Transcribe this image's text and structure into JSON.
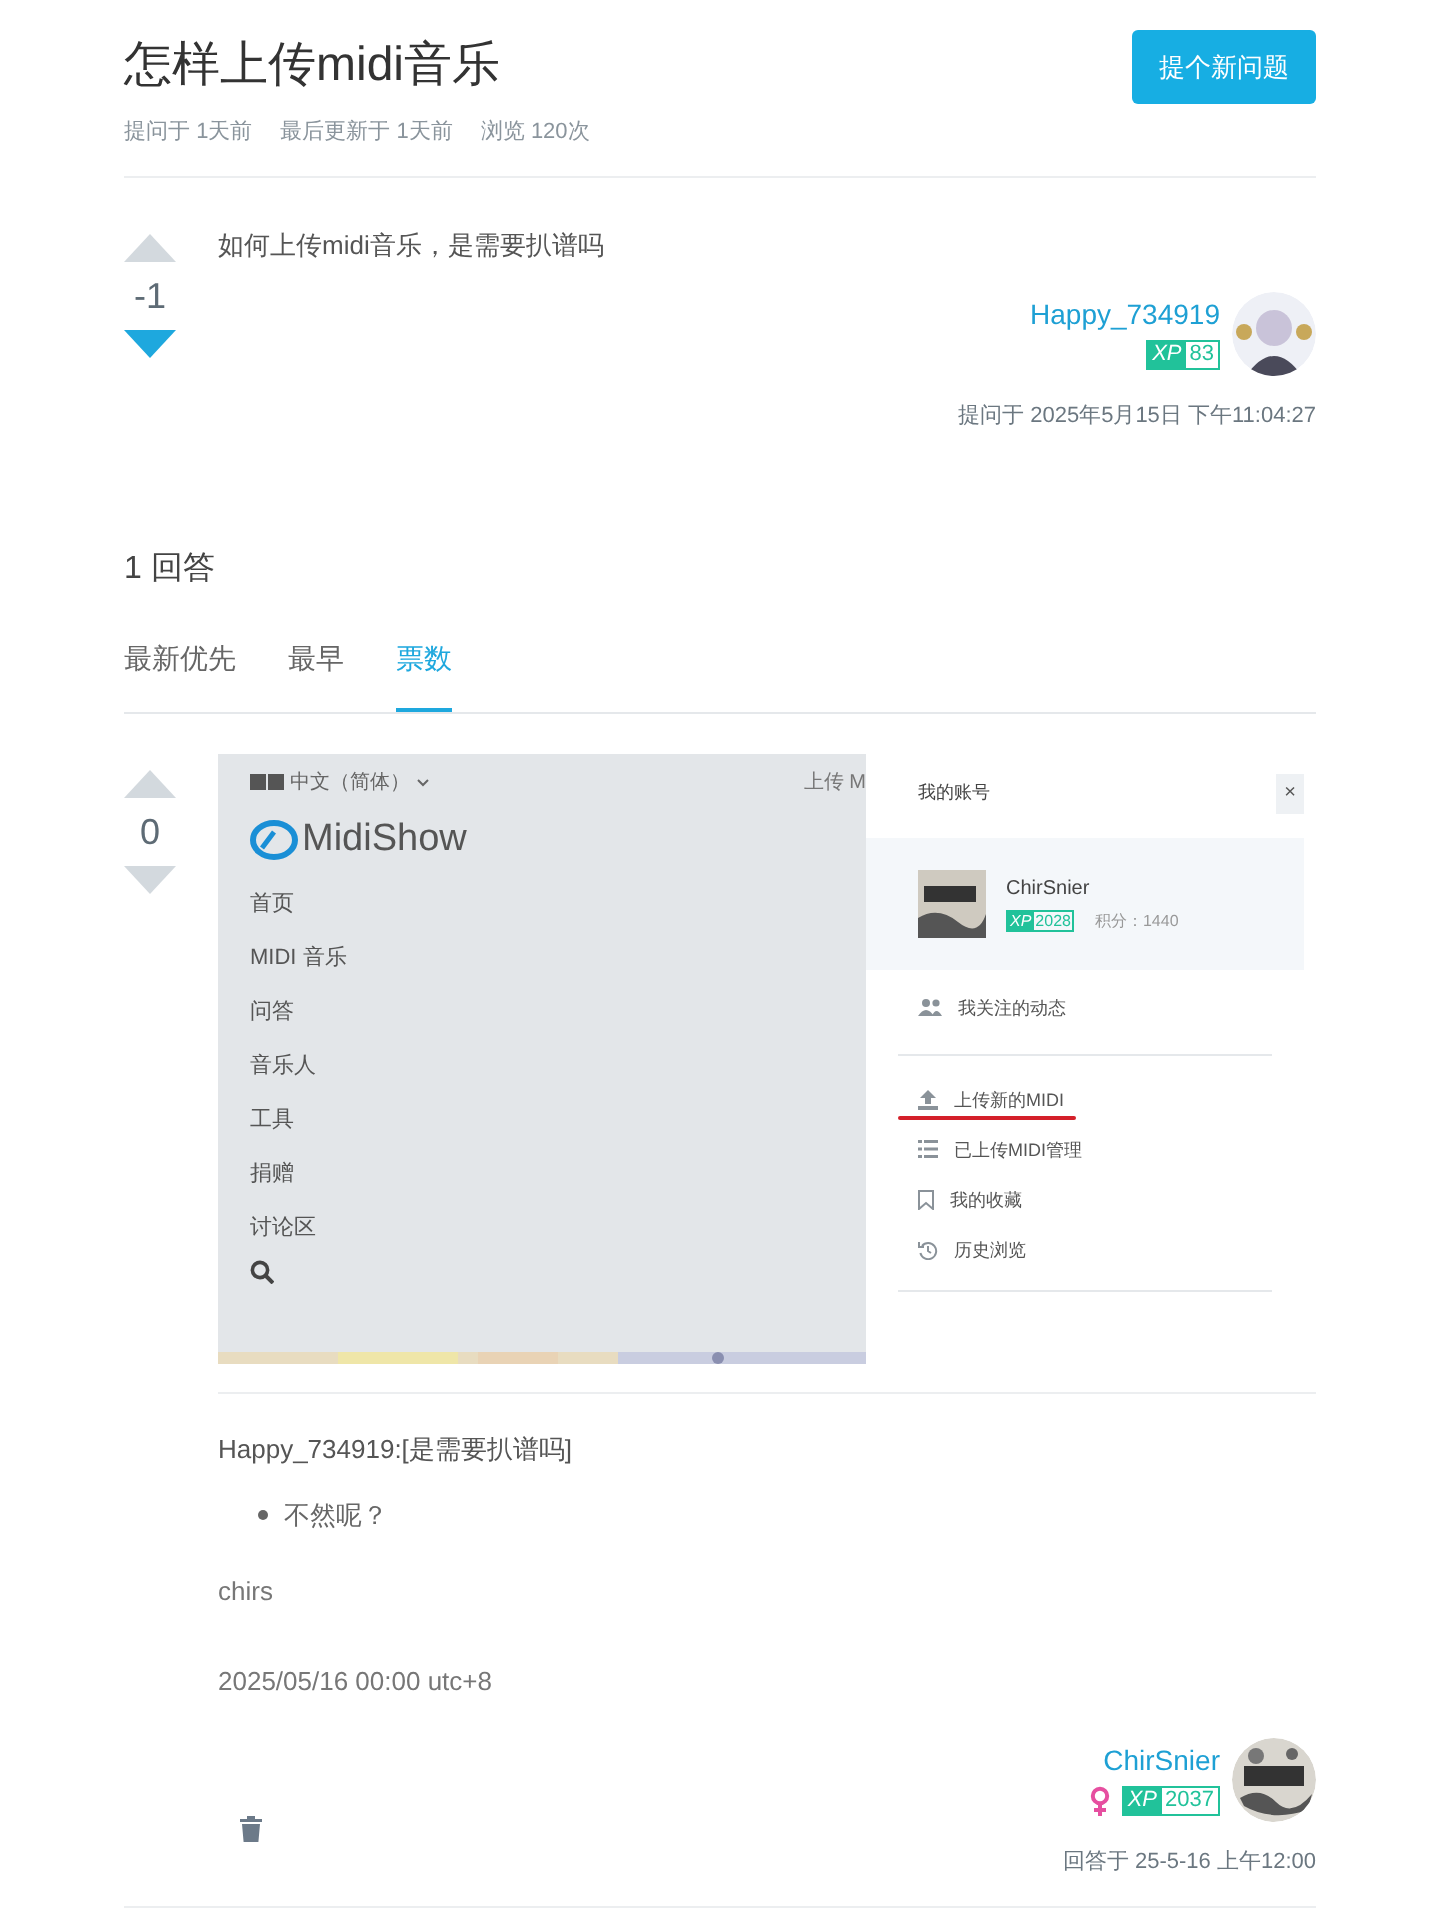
{
  "question": {
    "title": "怎样上传midi音乐",
    "ask_button": "提个新问题",
    "meta": [
      {
        "label": "提问于",
        "value": "1天前"
      },
      {
        "label": "最后更新于",
        "value": "1天前"
      },
      {
        "label": "浏览",
        "value": "120次"
      }
    ],
    "votes": {
      "count": "-1",
      "upvoted": false,
      "downvoted": true
    },
    "body": "如何上传midi音乐，是需要扒谱吗",
    "author": {
      "name": "Happy_734919",
      "female": false,
      "xp_label": "XP",
      "xp": "83"
    },
    "timestamp": "提问于 2025年5月15日 下午11:04:27"
  },
  "answers_heading": "1 回答",
  "sort_tabs": [
    {
      "label": "最新优先",
      "selected": false
    },
    {
      "label": "最早",
      "selected": false
    },
    {
      "label": "票数",
      "selected": true
    }
  ],
  "answers": [
    {
      "votes": {
        "count": "0",
        "upvoted": false,
        "downvoted": false
      },
      "screenshot": {
        "language": "中文（简体）",
        "logo": "MidiShow",
        "top_link": "上传 M",
        "nav": [
          "首页",
          "MIDI 音乐",
          "问答",
          "音乐人",
          "工具",
          "捐赠",
          "讨论区"
        ],
        "panel_title": "我的账号",
        "close": "×",
        "user": {
          "name": "ChirSnier",
          "xp_label": "XP",
          "xp": "2028",
          "points": "积分：1440"
        },
        "menu_groups": [
          [
            {
              "label": "我关注的动态",
              "kind": "users",
              "underlined": false
            }
          ],
          [
            {
              "label": "上传新的MIDI",
              "kind": "upload",
              "underlined": true
            },
            {
              "label": "已上传MIDI管理",
              "kind": "list",
              "underlined": false
            },
            {
              "label": "我的收藏",
              "kind": "bookmark",
              "underlined": false
            },
            {
              "label": "历史浏览",
              "kind": "history",
              "underlined": false
            }
          ]
        ]
      },
      "quote": "Happy_734919:[是需要扒谱吗]",
      "bullets": [
        "不然呢？"
      ],
      "signature": "chirs",
      "date": "2025/05/16 00:00 utc+8",
      "author": {
        "name": "ChirSnier",
        "female": true,
        "xp_label": "XP",
        "xp": "2037"
      },
      "timestamp": "回答于 25-5-16 上午12:00"
    }
  ]
}
